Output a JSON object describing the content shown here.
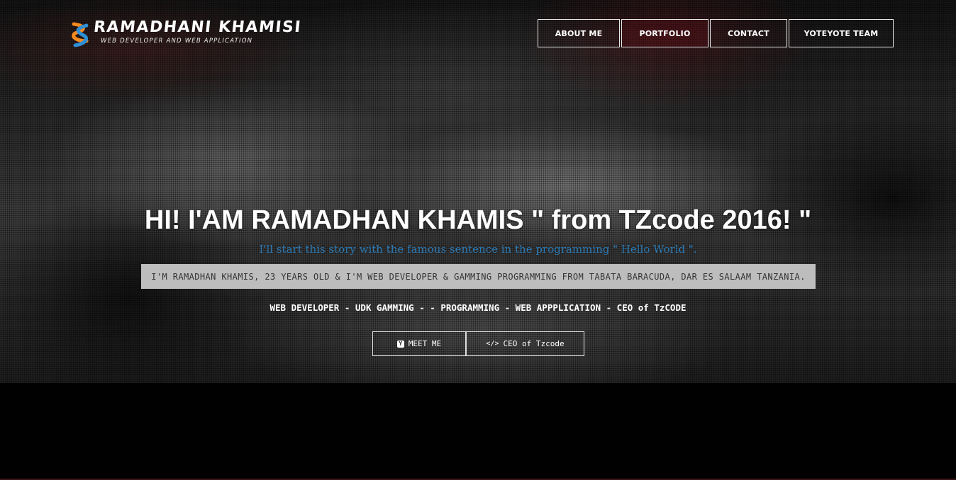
{
  "brand": {
    "name": "RAMADHANI KHAMISI",
    "tagline": "WEB DEVELOPER AND WEB APPLICATION",
    "colors": {
      "orange": "#f48a1f",
      "blue": "#2f8fd6"
    }
  },
  "nav": {
    "items": [
      {
        "label": "ABOUT ME"
      },
      {
        "label": "PORTFOLIO"
      },
      {
        "label": "CONTACT"
      },
      {
        "label": "YOTEYOTE TEAM"
      }
    ]
  },
  "hero": {
    "headline": "HI! I'AM RAMADHAN KHAMIS \" from TZcode 2016! \"",
    "subline": "I'll start this story with the famous sentence in the programming \" Hello World \".",
    "bio": "I'M RAMADHAN KHAMIS, 23 YEARS OLD & I'M WEB DEVELOPER & GAMMING PROGRAMMING FROM TABATA BARACUDA, DAR ES SALAAM TANZANIA.",
    "skills": "WEB DEVELOPER - UDK GAMMING - - PROGRAMMING - WEB APPPLICATION - CEO of TzCODE",
    "subline_color": "#2a79b5"
  },
  "cta": {
    "meet_label": "MEET ME",
    "meet_icon": "y-box-icon",
    "ceo_label": "CEO of Tzcode",
    "ceo_icon_glyph": "</>",
    "ceo_icon": "code-icon"
  }
}
